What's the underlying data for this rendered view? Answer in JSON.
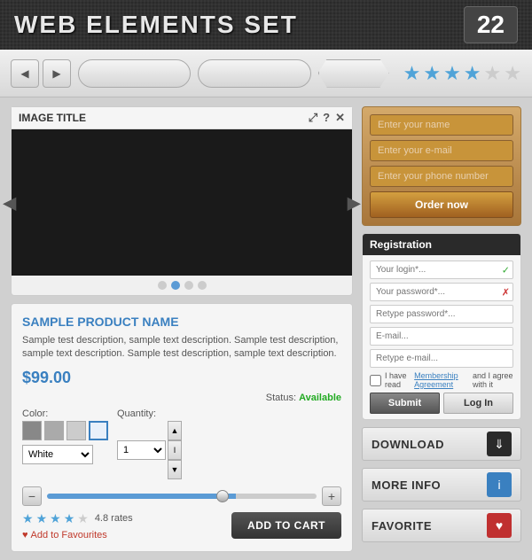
{
  "header": {
    "title": "WEB ELEMENTS SET",
    "number": "22"
  },
  "navbar": {
    "stars_filled": 4,
    "stars_total": 6
  },
  "image_viewer": {
    "title": "IMAGE TITLE",
    "icons": [
      "⤢",
      "?",
      "✕"
    ],
    "dots_count": 4,
    "active_dot": 1
  },
  "product": {
    "name": "SAMPLE PRODUCT NAME",
    "description": "Sample test description, sample text description. Sample test description, sample text description. Sample test description, sample text description.",
    "price": "$99.00",
    "status_label": "Status:",
    "status_value": "Available",
    "color_label": "Color:",
    "color_default": "White",
    "quantity_label": "Quantity:",
    "add_to_favourites": "Add to Favourites",
    "add_to_cart": "ADD TO CART",
    "rating": "4.8 rates"
  },
  "order_form": {
    "name_placeholder": "Enter your name",
    "email_placeholder": "Enter your e-mail",
    "phone_placeholder": "Enter your phone number",
    "button_label": "Order now"
  },
  "registration": {
    "title": "Registration",
    "login_placeholder": "Your login*...",
    "password_placeholder": "Your password*...",
    "retype_placeholder": "Retype password*...",
    "email_placeholder": "E-mail...",
    "retype_email_placeholder": "Retype e-mail...",
    "agree_text": "I have read",
    "agree_link": "Membership Agreement",
    "agree_suffix": "and I agree with it",
    "submit_label": "Submit",
    "login_label": "Log In"
  },
  "actions": [
    {
      "label": "DOWNLOAD",
      "icon": "⇓",
      "icon_type": "dark"
    },
    {
      "label": "MORE INFO",
      "icon": "i",
      "icon_type": "blue"
    },
    {
      "label": "FAVORITE",
      "icon": "♥",
      "icon_type": "red"
    }
  ]
}
